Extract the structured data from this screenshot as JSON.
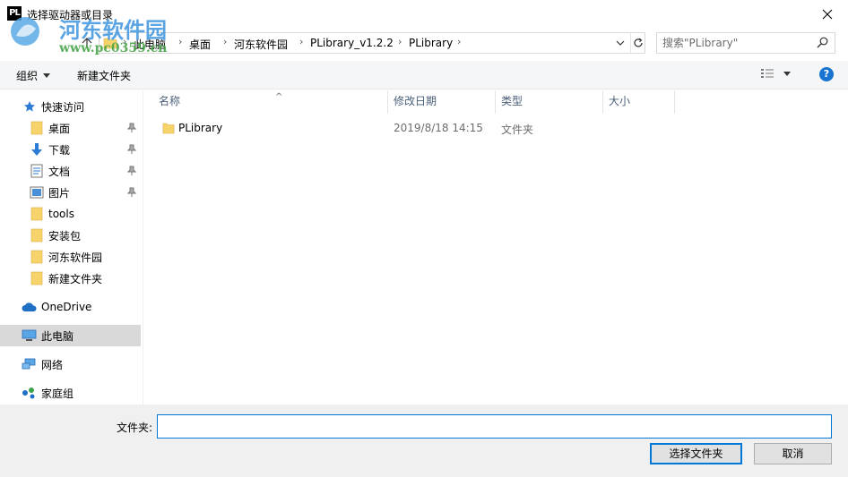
{
  "window": {
    "icon_text": "PL",
    "title": "选择驱动器或目录"
  },
  "watermark": {
    "line1": "河东软件园",
    "line2": "www.pc0359.cn"
  },
  "address": {
    "crumbs": [
      "此电脑",
      "桌面",
      "河东软件园",
      "PLibrary_v1.2.2",
      "PLibrary"
    ]
  },
  "search": {
    "placeholder": "搜索\"PLibrary\""
  },
  "toolbar": {
    "organize_label": "组织",
    "new_folder_label": "新建文件夹"
  },
  "nav": {
    "quick_access": "快速访问",
    "items": [
      {
        "label": "桌面",
        "icon": "folder-icon",
        "pinned": true
      },
      {
        "label": "下载",
        "icon": "download-icon",
        "pinned": true
      },
      {
        "label": "文档",
        "icon": "document-icon",
        "pinned": true
      },
      {
        "label": "图片",
        "icon": "picture-icon",
        "pinned": true
      },
      {
        "label": "tools",
        "icon": "folder-icon",
        "pinned": false
      },
      {
        "label": "安装包",
        "icon": "folder-icon",
        "pinned": false
      },
      {
        "label": "河东软件园",
        "icon": "folder-icon",
        "pinned": false
      },
      {
        "label": "新建文件夹",
        "icon": "folder-icon",
        "pinned": false
      }
    ],
    "onedrive": "OneDrive",
    "this_pc": "此电脑",
    "network": "网络",
    "homegroup": "家庭组"
  },
  "columns": {
    "name": "名称",
    "modified": "修改日期",
    "type": "类型",
    "size": "大小"
  },
  "files": [
    {
      "name": "PLibrary",
      "modified": "2019/8/18 14:15",
      "type": "文件夹",
      "size": ""
    }
  ],
  "bottom": {
    "folder_label": "文件夹:",
    "folder_value": "",
    "select_button": "选择文件夹",
    "cancel_button": "取消"
  },
  "colors": {
    "accent": "#0078d7",
    "folder": "#f7d46b",
    "help": "#1874d0",
    "selected_bg": "#d9d9d9"
  }
}
